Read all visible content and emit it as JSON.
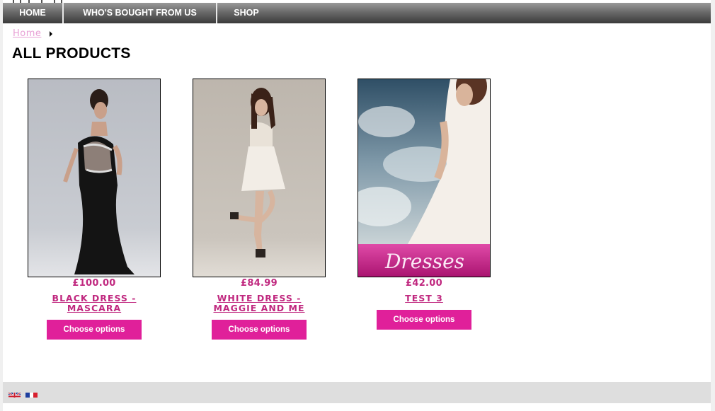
{
  "nav": {
    "items": [
      {
        "label": "HOME"
      },
      {
        "label": "WHO'S BOUGHT FROM US"
      },
      {
        "label": "SHOP"
      }
    ]
  },
  "breadcrumb": {
    "home_label": "Home"
  },
  "page": {
    "title": "ALL PRODUCTS"
  },
  "products": [
    {
      "name": "BLACK DRESS - MASCARA",
      "price": "£100.00",
      "button_label": "Choose options"
    },
    {
      "name": "WHITE DRESS - MAGGIE AND ME",
      "price": "£84.99",
      "button_label": "Choose options"
    },
    {
      "name": "TEST 3",
      "price": "£42.00",
      "button_label": "Choose options",
      "image_text": "Dresses"
    }
  ],
  "footer": {
    "languages": [
      {
        "icon": "uk-flag-icon"
      },
      {
        "icon": "french-flag-icon"
      }
    ]
  },
  "colors": {
    "accent": "#e0209a",
    "price_text": "#c0287f",
    "breadcrumb_link": "#e8a0d6"
  }
}
